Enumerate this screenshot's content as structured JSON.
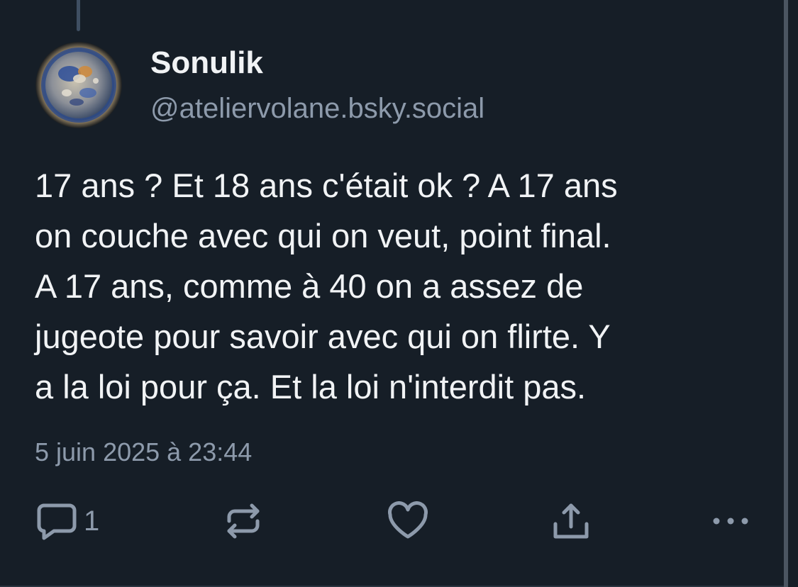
{
  "post": {
    "author": {
      "display_name": "Sonulik",
      "handle": "@ateliervolane.bsky.social",
      "avatar_icon": "ceramic-plate-avatar"
    },
    "text": "17 ans ? Et 18 ans c'était ok ? A 17 ans\non couche avec qui on veut, point final.\nA 17 ans, comme à 40 on a assez de\njugeote pour savoir avec qui on flirte. Y\na la loi pour ça. Et la loi n'interdit pas.",
    "timestamp": "5 juin 2025 à 23:44",
    "actions": {
      "reply_icon": "reply-bubble-icon",
      "reply_count": "1",
      "repost_icon": "repost-icon",
      "like_icon": "heart-icon",
      "share_icon": "share-icon",
      "more_icon": "more-dots-icon"
    }
  },
  "colors": {
    "background": "#161e27",
    "text_primary": "#f1f3f5",
    "text_secondary": "#8d9aab",
    "icon": "#8d9aab",
    "thread_line": "#3f4f62"
  }
}
